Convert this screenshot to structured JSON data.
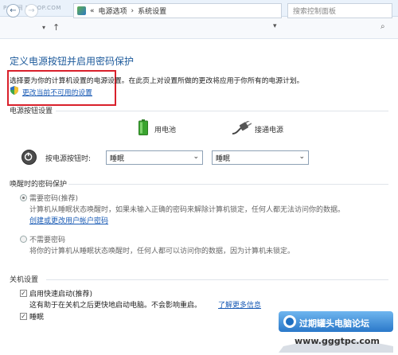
{
  "watermark_top": "PC时间 PCPOP.COM",
  "window": {
    "title": "系统设置",
    "controls": [
      "—",
      "☐",
      "✕"
    ]
  },
  "address": {
    "crumb_prefix": "«",
    "crumb_1": "电源选项",
    "crumb_sep": "›",
    "crumb_2": "系统设置",
    "search_placeholder": "搜索控制面板"
  },
  "page": {
    "title": "定义电源按钮并启用密码保护",
    "intro": "选择要为你的计算机设置的电源设置。在此页上对设置所做的更改将应用于你所有的电源计划。",
    "change_link": "更改当前不可用的设置"
  },
  "power_buttons": {
    "section": "电源按钮设置",
    "battery_label": "用电池",
    "ac_label": "接通电源",
    "row_label": "按电源按钮时:",
    "battery_value": "睡眠",
    "ac_value": "睡眠"
  },
  "wake": {
    "section": "唤醒时的密码保护",
    "opt1_label": "需要密码(推荐)",
    "opt1_desc": "计算机从睡眠状态唤醒时，如果未输入正确的密码来解除计算机锁定，任何人都无法访问你的数据。",
    "opt1_link": "创建或更改用户帐户密码",
    "opt2_label": "不需要密码",
    "opt2_desc": "将你的计算机从睡眠状态唤醒时，任何人都可以访问你的数据，因为计算机未锁定。"
  },
  "shutdown": {
    "section": "关机设置",
    "fast_label": "启用快速启动(推荐)",
    "fast_desc": "这有助于在关机之后更快地启动电脑。不会影响重启。",
    "fast_link": "了解更多信息",
    "sleep_label": "睡眠"
  },
  "site_badge": {
    "name": "过期罐头电脑论坛",
    "url": "www.gggtpc.com"
  },
  "colors": {
    "accent_title": "#1d5a9b",
    "link": "#1a5bb5",
    "highlight": "#d9202b",
    "battery": "#3aa42f"
  }
}
